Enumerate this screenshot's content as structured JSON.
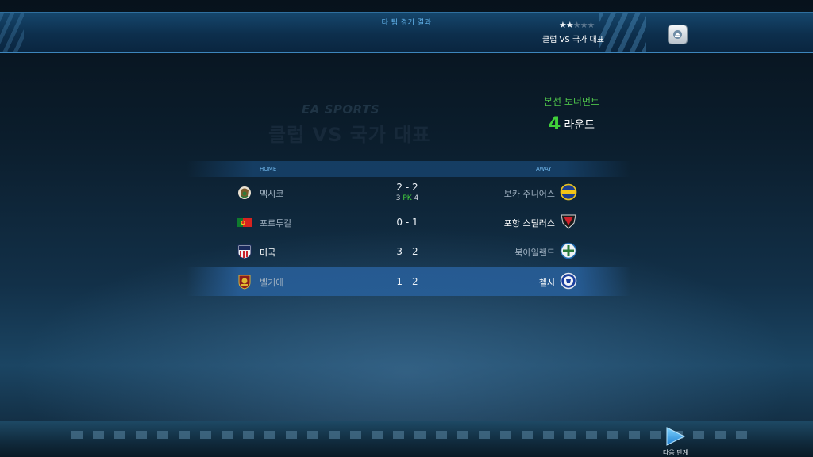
{
  "header": {
    "screen_title": "타 팀 경기 결과",
    "mode_label": "클럽 VS 국가 대표",
    "stars_filled": 2,
    "stars_total": 5,
    "home_icon": "home-icon"
  },
  "watermark": {
    "logo": "EA SPORTS",
    "title": "클럽 VS 국가 대표"
  },
  "tournament": {
    "label": "본선 토너먼트",
    "round_number": "4",
    "round_label": "라운드"
  },
  "table": {
    "home_header": "HOME",
    "away_header": "AWAY",
    "rows": [
      {
        "home": "멕시코",
        "score": "2 - 2",
        "pk_home": "3",
        "pk_label": "PK",
        "pk_away": "4",
        "away": "보카 주니어스",
        "home_icon": "mexico-flag-icon",
        "away_icon": "boca-juniors-crest-icon"
      },
      {
        "home": "포르투갈",
        "score": "0 - 1",
        "away": "포항 스틸러스",
        "home_icon": "portugal-flag-icon",
        "away_icon": "pohang-steelers-crest-icon"
      },
      {
        "home": "미국",
        "score": "3 - 2",
        "away": "북아일랜드",
        "home_icon": "usa-crest-icon",
        "away_icon": "northern-ireland-crest-icon"
      },
      {
        "home": "벨기에",
        "score": "1 - 2",
        "away": "첼시",
        "home_icon": "belgium-crest-icon",
        "away_icon": "chelsea-crest-icon"
      }
    ]
  },
  "footer": {
    "next_label": "다음 단계",
    "next_icon": "play-arrow-icon"
  },
  "colors": {
    "accent_green": "#41d13a",
    "header_blue": "#15466c",
    "highlight_row": "#28609c"
  }
}
